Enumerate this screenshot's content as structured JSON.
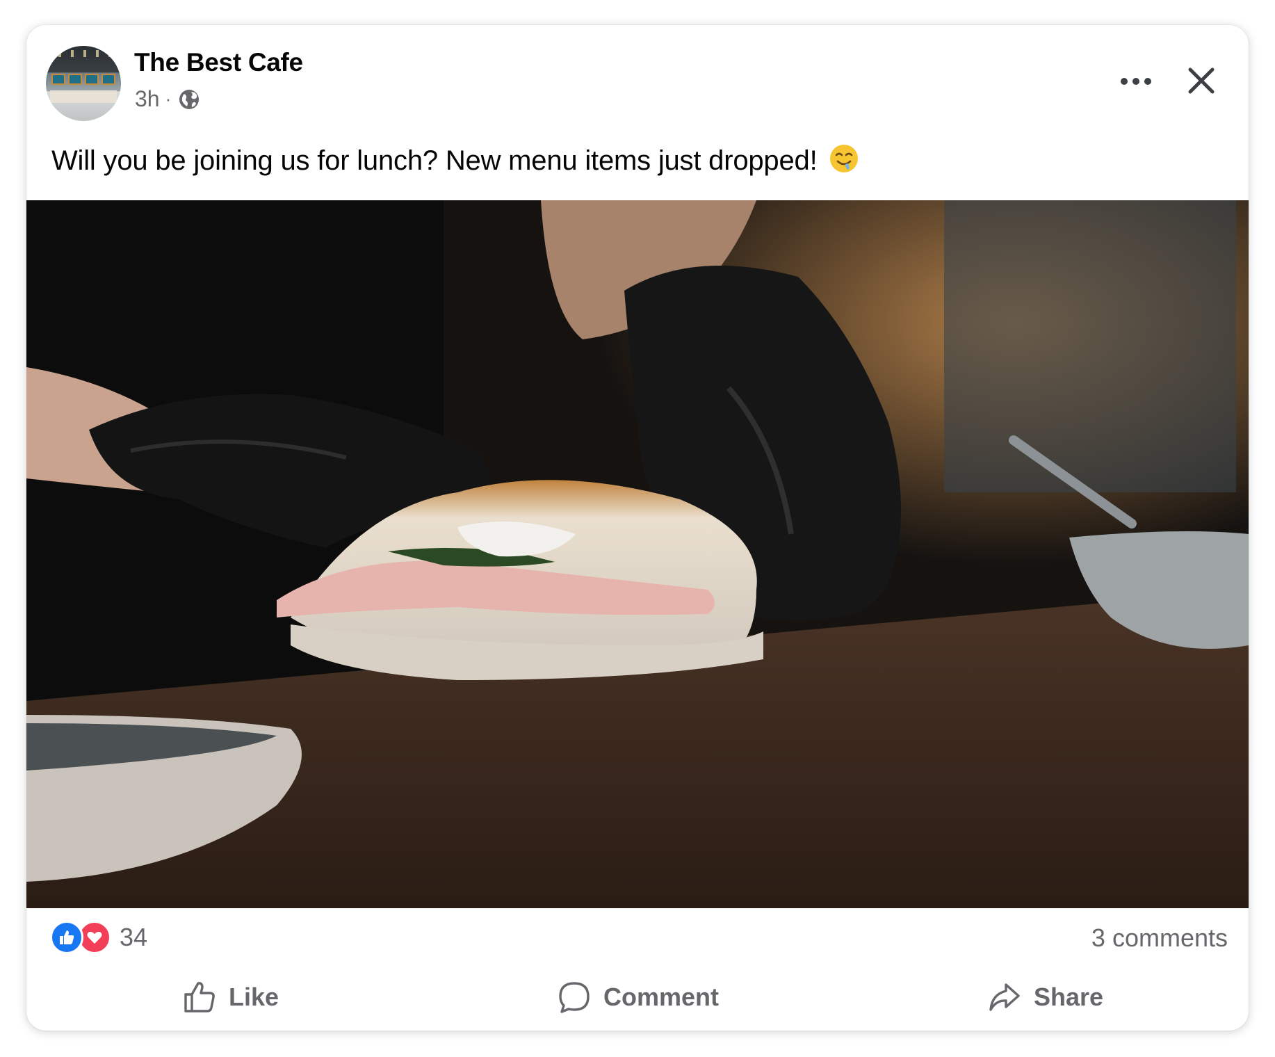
{
  "post": {
    "page_name": "The Best Cafe",
    "time": "3h",
    "separator": "·",
    "audience_icon": "globe-icon",
    "text": "Will you be joining us for lunch? New menu items just dropped!",
    "emoji": "drooling-face",
    "photo": "gloved hands assembling a ham sandwich on focaccia"
  },
  "header": {
    "more_icon": "more-horizontal-icon",
    "close_icon": "close-icon"
  },
  "stats": {
    "reactions_count": "34",
    "reaction_types": [
      "like",
      "love"
    ],
    "comments": "3 comments"
  },
  "actions": {
    "like": "Like",
    "comment": "Comment",
    "share": "Share"
  },
  "colors": {
    "like_blue": "#1877f2",
    "love_red": "#f33e58",
    "secondary_text": "#65676b",
    "primary_text": "#050505"
  }
}
